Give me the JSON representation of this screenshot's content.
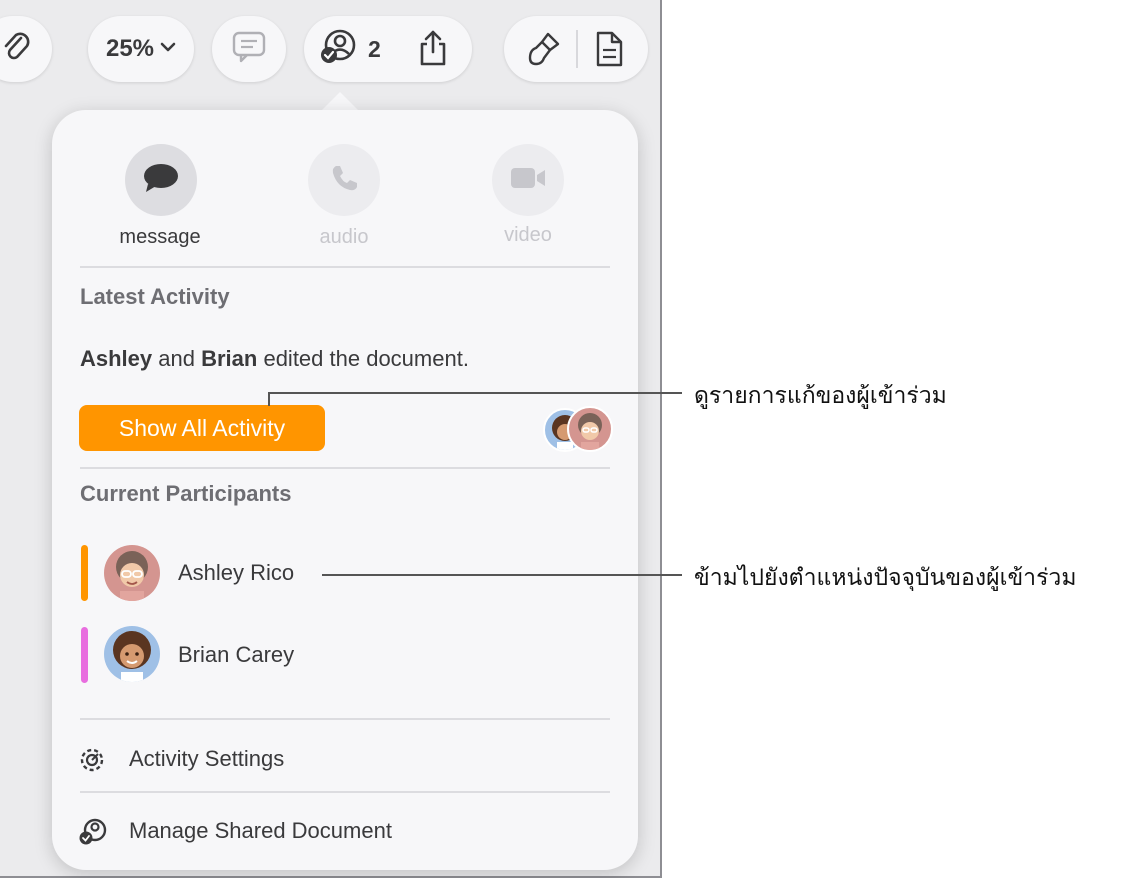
{
  "toolbar": {
    "zoom_label": "25%",
    "participants_count": "2"
  },
  "popover": {
    "message_label": "message",
    "audio_label": "audio",
    "video_label": "video",
    "latest_activity_title": "Latest Activity",
    "activity_name1": "Ashley",
    "activity_and": " and ",
    "activity_name2": "Brian",
    "activity_rest": " edited the document.",
    "show_all_button": "Show All Activity",
    "current_participants_title": "Current Participants",
    "participants": [
      {
        "name": "Ashley Rico",
        "color": "#ff9500"
      },
      {
        "name": "Brian Carey",
        "color": "#e86ddf"
      }
    ],
    "activity_settings": "Activity Settings",
    "manage_shared": "Manage Shared Document"
  },
  "callouts": {
    "show_activity": "ดูรายการแก้ของผู้เข้าร่วม",
    "jump_to_participant": "ข้ามไปยังตำแหน่งปัจจุบันของผู้เข้าร่วม"
  },
  "colors": {
    "accent_orange": "#ff9500",
    "participant_pink": "#e86ddf"
  }
}
